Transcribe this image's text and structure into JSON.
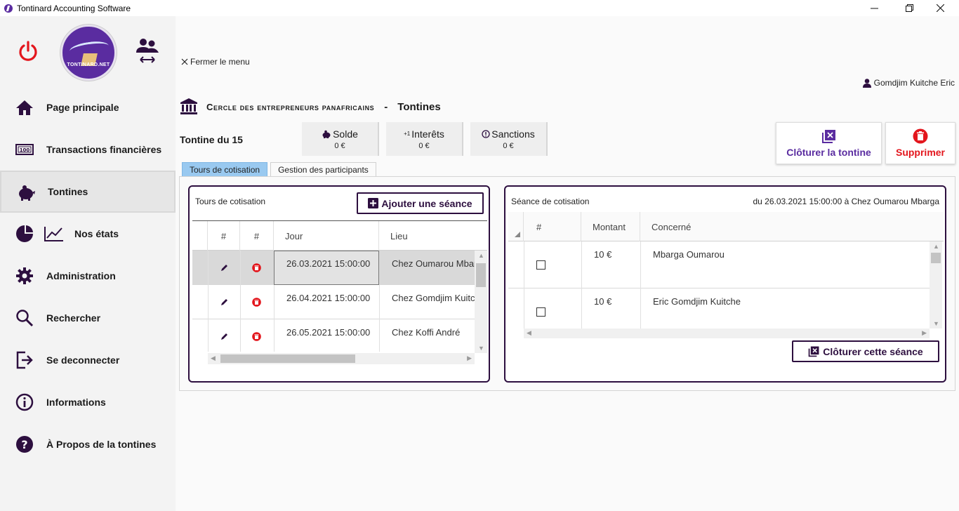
{
  "window": {
    "title": "Tontinard Accounting Software",
    "minimize": "—",
    "maximize": "❐",
    "close": "✕"
  },
  "sidebar": {
    "logo_text": "TONTINARD.NET",
    "items": [
      {
        "label": "Page principale"
      },
      {
        "label": "Transactions financières"
      },
      {
        "label": "Tontines"
      },
      {
        "label": "Nos états"
      },
      {
        "label": "Administration"
      },
      {
        "label": "Rechercher"
      },
      {
        "label": "Se deconnecter"
      },
      {
        "label": "Informations"
      },
      {
        "label": "À Propos de la  tontines"
      }
    ]
  },
  "header": {
    "close_menu": "Fermer le menu",
    "user": "Gomdjim Kuitche Eric",
    "org_name": "Cercle des entrepreneurs panafricains",
    "separator": "-",
    "section": "Tontines"
  },
  "tontine": {
    "name": "Tontine du 15",
    "stats": [
      {
        "label": "Solde",
        "value": "0 €"
      },
      {
        "label": "Interêts",
        "prefix": "+1",
        "value": "0 €"
      },
      {
        "label": "Sanctions",
        "value": "0 €"
      }
    ],
    "close_tontine": "Clôturer la tontine",
    "delete": "Supprimer"
  },
  "tabs": [
    {
      "label": "Tours de cotisation"
    },
    {
      "label": "Gestion des participants"
    }
  ],
  "tours": {
    "title": "Tours de cotisation",
    "add_button": "Ajouter une séance",
    "columns": [
      "#",
      "#",
      "Jour",
      "Lieu"
    ],
    "rows": [
      {
        "jour": "26.03.2021 15:00:00",
        "lieu": "Chez Oumarou Mbarga"
      },
      {
        "jour": "26.04.2021 15:00:00",
        "lieu": "Chez Gomdjim Kuitche"
      },
      {
        "jour": "26.05.2021 15:00:00",
        "lieu": "Chez Koffi André"
      }
    ]
  },
  "seance": {
    "title": "Séance de cotisation",
    "info": "du 26.03.2021 15:00:00 à Chez Oumarou Mbarga",
    "columns": [
      "#",
      "Montant",
      "Concerné"
    ],
    "rows": [
      {
        "montant": "10 €",
        "concerne": "Mbarga Oumarou",
        "checked": false
      },
      {
        "montant": "10 €",
        "concerne": "Eric Gomdjim Kuitche",
        "checked": false
      }
    ],
    "close_button": "Clôturer cette séance"
  },
  "colors": {
    "accent": "#2d0f3f",
    "danger": "#e3161d",
    "purple": "#5a2ca0",
    "tab_active": "#99c9f0"
  }
}
